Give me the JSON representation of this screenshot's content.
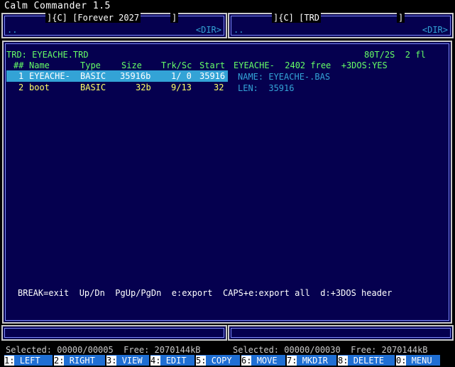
{
  "app": {
    "title": "Calm Commander 1.5"
  },
  "left_panel": {
    "header": "]{C] [Forever 2027",
    "header_end": "]",
    "updir": "..",
    "dir_tag": "<DIR>"
  },
  "right_panel": {
    "header": "]{C] [TRD",
    "header_end": "]",
    "updir": "..",
    "dir_tag": "<DIR>"
  },
  "dialog": {
    "title": "TRD: EYEACHE.TRD",
    "info": "80T/2S  2 fl",
    "columns": [
      "##",
      "Name",
      "Type",
      "Size",
      "Trk/Sc",
      "Start"
    ],
    "header_right": "EYEACHE-  2402 free  +3DOS:YES",
    "files": [
      {
        "num": "1",
        "name": "EYEACHE-",
        "type": "BASIC",
        "size": "35916b",
        "trksc": "1/ 0",
        "start": "35916",
        "selected": true
      },
      {
        "num": "2",
        "name": "boot",
        "type": "BASIC",
        "size": "32b",
        "trksc": "9/13",
        "start": "32",
        "selected": false
      }
    ],
    "detail": {
      "name_line": "NAME: EYEACHE-.BAS",
      "len_line": "LEN:  35916"
    },
    "help": "BREAK=exit  Up/Dn  PgUp/PgDn  e:export  CAPS+e:export all  d:+3DOS header"
  },
  "status": {
    "left": "Selected: 00000/00005  Free: 2070144kB",
    "right": "Selected: 00000/00030  Free: 2070144kB"
  },
  "function_keys": [
    {
      "num": "1:",
      "label": "LEFT"
    },
    {
      "num": "2:",
      "label": "RIGHT"
    },
    {
      "num": "3:",
      "label": "VIEW"
    },
    {
      "num": "4:",
      "label": "EDIT"
    },
    {
      "num": "5:",
      "label": "COPY"
    },
    {
      "num": "6:",
      "label": "MOVE"
    },
    {
      "num": "7:",
      "label": "MKDIR"
    },
    {
      "num": "8:",
      "label": "DELETE"
    },
    {
      "num": "0:",
      "label": "MENU"
    }
  ],
  "colors": {
    "background": "#05004f",
    "cyan": "#33a3d6",
    "green": "#66ff66",
    "yellow": "#ffff66",
    "fkey_bar": "#1f6fd4"
  }
}
